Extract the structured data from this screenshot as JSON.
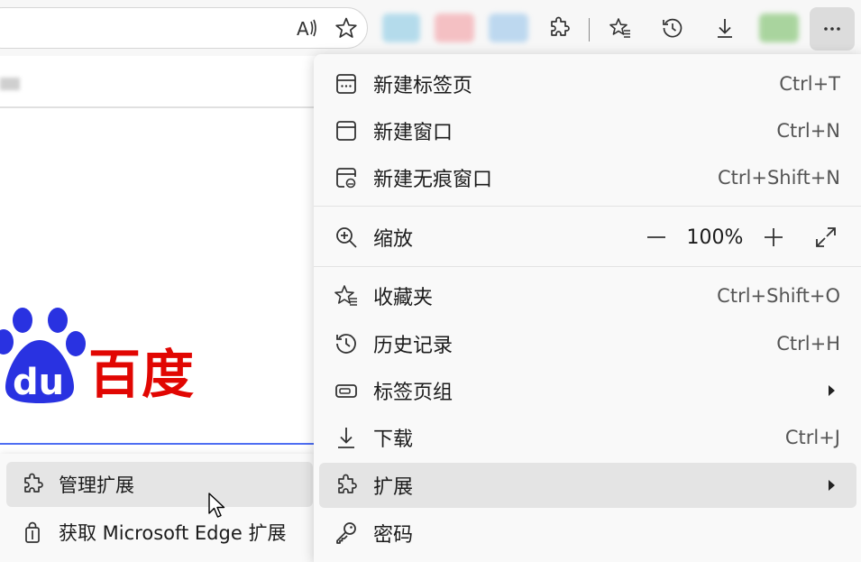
{
  "toolbar": {
    "read_aloud_icon_text": "A",
    "buttons": [
      "read-aloud",
      "favorite",
      "extensions",
      "favorites",
      "history",
      "downloads",
      "more"
    ]
  },
  "brand": {
    "logo_text": "du",
    "name": "百度",
    "colors": {
      "blue": "#2932e1",
      "red": "#e10602"
    }
  },
  "menu": {
    "items": [
      {
        "label": "新建标签页",
        "shortcut": "Ctrl+T"
      },
      {
        "label": "新建窗口",
        "shortcut": "Ctrl+N"
      },
      {
        "label": "新建无痕窗口",
        "shortcut": "Ctrl+Shift+N"
      },
      {
        "label": "缩放",
        "zoom_value": "100%"
      },
      {
        "label": "收藏夹",
        "shortcut": "Ctrl+Shift+O"
      },
      {
        "label": "历史记录",
        "shortcut": "Ctrl+H"
      },
      {
        "label": "标签页组"
      },
      {
        "label": "下载",
        "shortcut": "Ctrl+J"
      },
      {
        "label": "扩展"
      },
      {
        "label": "密码"
      }
    ]
  },
  "submenu": {
    "items": [
      {
        "label": "管理扩展"
      },
      {
        "label": "获取 Microsoft Edge 扩展"
      }
    ]
  }
}
